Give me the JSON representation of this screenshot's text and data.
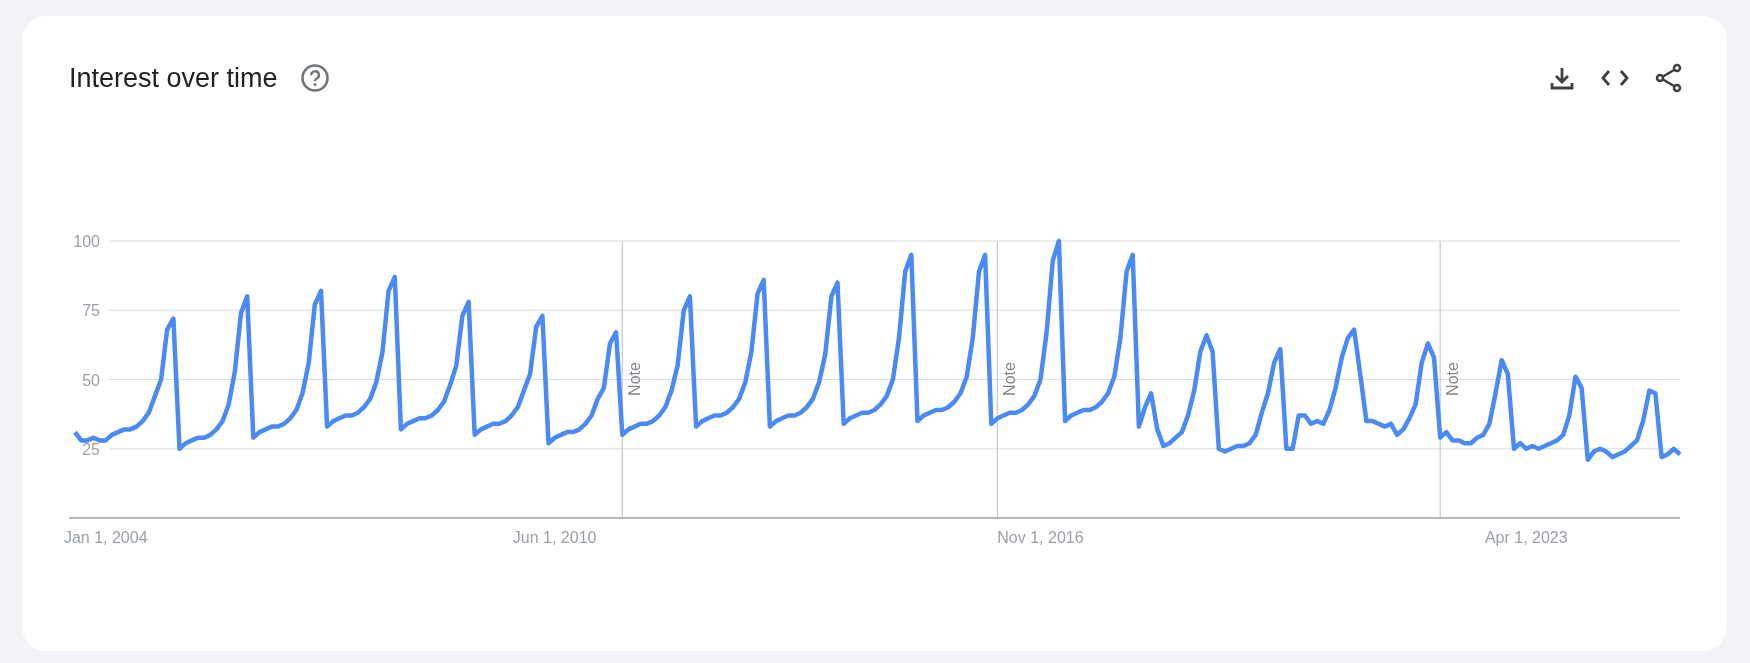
{
  "card": {
    "title": "Interest over time",
    "chart_data": {
      "type": "line",
      "grid": true,
      "ylim": [
        0,
        100
      ],
      "categories": [
        null,
        null,
        null,
        null,
        null,
        "Jan 1, 2004",
        null,
        null,
        null,
        null,
        null,
        null,
        null,
        null,
        null,
        null,
        null,
        null,
        null,
        null,
        null,
        null,
        null,
        null,
        null,
        null,
        null,
        null,
        null,
        null,
        null,
        null,
        null,
        null,
        null,
        null,
        null,
        null,
        null,
        null,
        null,
        null,
        null,
        null,
        null,
        null,
        null,
        null,
        null,
        null,
        null,
        null,
        null,
        null,
        null,
        null,
        null,
        null,
        null,
        null,
        null,
        null,
        null,
        null,
        null,
        null,
        null,
        null,
        null,
        null,
        null,
        null,
        null,
        null,
        null,
        null,
        null,
        null,
        "Jun 1, 2010",
        null,
        null,
        null,
        null,
        null,
        null,
        null,
        null,
        null,
        null,
        null,
        null,
        null,
        null,
        null,
        null,
        null,
        null,
        null,
        null,
        null,
        null,
        null,
        null,
        null,
        null,
        null,
        null,
        null,
        null,
        null,
        null,
        null,
        null,
        null,
        null,
        null,
        null,
        null,
        null,
        null,
        null,
        null,
        null,
        null,
        null,
        null,
        null,
        null,
        null,
        null,
        null,
        null,
        null,
        null,
        null,
        null,
        null,
        null,
        null,
        null,
        null,
        null,
        null,
        null,
        null,
        null,
        null,
        null,
        null,
        null,
        null,
        null,
        null,
        null,
        null,
        null,
        null,
        "Nov 1, 2016",
        null,
        null,
        null,
        null,
        null,
        null,
        null,
        null,
        null,
        null,
        null,
        null,
        null,
        null,
        null,
        null,
        null,
        null,
        null,
        null,
        null,
        null,
        null,
        null,
        null,
        null,
        null,
        null,
        null,
        null,
        null,
        null,
        null,
        null,
        null,
        null,
        null,
        null,
        null,
        null,
        null,
        null,
        null,
        null,
        null,
        null,
        null,
        null,
        null,
        null,
        null,
        null,
        null,
        null,
        null,
        null,
        null,
        null,
        null,
        null,
        null,
        null,
        null,
        null,
        null,
        null,
        null,
        null,
        null,
        null,
        null,
        null,
        null,
        null,
        null,
        null,
        null,
        null,
        "Apr 1, 2023",
        null,
        null,
        null,
        null,
        null,
        null,
        null,
        null,
        null,
        null,
        null,
        null,
        null,
        null,
        null,
        null,
        null,
        null,
        null,
        null,
        null,
        null,
        null,
        null,
        null
      ],
      "yticks": [
        25,
        50,
        75,
        100
      ],
      "annotations": [
        "Note",
        "Note",
        "Note"
      ],
      "series": [
        {
          "color": "#4a8af4",
          "values": [
            31,
            28,
            28,
            29,
            28,
            28,
            30,
            31,
            32,
            32,
            33,
            35,
            38,
            44,
            50,
            68,
            72,
            25,
            27,
            28,
            29,
            29,
            30,
            32,
            35,
            41,
            53,
            74,
            80,
            29,
            31,
            32,
            33,
            33,
            34,
            36,
            39,
            45,
            56,
            77,
            82,
            33,
            35,
            36,
            37,
            37,
            38,
            40,
            43,
            49,
            60,
            82,
            87,
            32,
            34,
            35,
            36,
            36,
            37,
            39,
            42,
            48,
            55,
            73,
            78,
            30,
            32,
            33,
            34,
            34,
            35,
            37,
            40,
            46,
            52,
            69,
            73,
            27,
            29,
            30,
            31,
            31,
            32,
            34,
            37,
            43,
            47,
            63,
            67,
            30,
            32,
            33,
            34,
            34,
            35,
            37,
            40,
            46,
            55,
            75,
            80,
            33,
            35,
            36,
            37,
            37,
            38,
            40,
            43,
            49,
            60,
            81,
            86,
            33,
            35,
            36,
            37,
            37,
            38,
            40,
            43,
            49,
            59,
            80,
            85,
            34,
            36,
            37,
            38,
            38,
            39,
            41,
            44,
            50,
            65,
            89,
            95,
            35,
            37,
            38,
            39,
            39,
            40,
            42,
            45,
            51,
            65,
            89,
            95,
            34,
            36,
            37,
            38,
            38,
            39,
            41,
            44,
            50,
            67,
            93,
            100,
            35,
            37,
            38,
            39,
            39,
            40,
            42,
            45,
            51,
            65,
            89,
            95,
            33,
            40,
            45,
            32,
            26,
            27,
            29,
            31,
            37,
            46,
            60,
            66,
            60,
            25,
            24,
            25,
            26,
            26,
            27,
            30,
            38,
            45,
            56,
            61,
            25,
            25,
            37,
            37,
            34,
            35,
            34,
            39,
            47,
            58,
            65,
            68,
            52,
            35,
            35,
            34,
            33,
            34,
            30,
            32,
            36,
            41,
            56,
            63,
            58,
            29,
            31,
            28,
            28,
            27,
            27,
            29,
            30,
            34,
            45,
            57,
            52,
            25,
            27,
            25,
            26,
            25,
            26,
            27,
            28,
            30,
            37,
            51,
            47,
            21,
            24,
            25,
            24,
            22,
            23,
            24,
            26,
            28,
            35,
            46,
            45,
            22,
            23,
            25,
            23
          ]
        }
      ]
    }
  }
}
